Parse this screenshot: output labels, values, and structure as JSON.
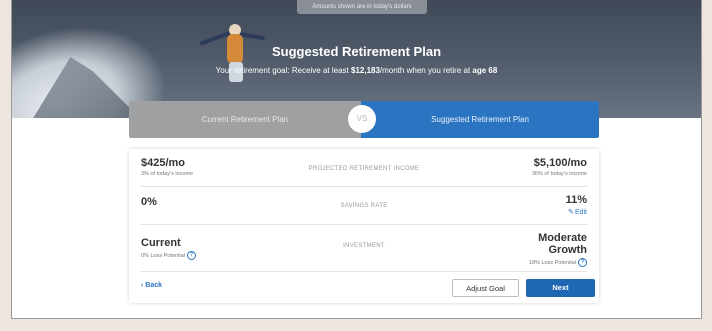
{
  "hero": {
    "amounts_tag": "Amounts shown are in today's dollars",
    "title": "Suggested Retirement Plan",
    "subtitle_prefix": "Your retirement goal: Receive at least ",
    "goal_amount": "$12,183",
    "subtitle_mid": "/month when you retire at ",
    "retire_age": "age 68"
  },
  "tabs": {
    "current_label": "Current Retirement Plan",
    "vs_label": "VS",
    "suggested_label": "Suggested Retirement Plan"
  },
  "rows": {
    "income": {
      "left_value": "$425/mo",
      "left_sub": "3% of today's income",
      "label": "PROJECTED RETIREMENT INCOME",
      "right_value": "$5,100/mo",
      "right_sub": "36% of today's income"
    },
    "savings": {
      "left_value": "0%",
      "label": "SAVINGS RATE",
      "right_value": "11%",
      "edit_label": "Edit"
    },
    "investment": {
      "left_value": "Current",
      "left_sub": "0% Loss Potential",
      "label": "INVESTMENT",
      "right_value_line1": "Moderate",
      "right_value_line2": "Growth",
      "right_sub": "18% Loss Potential"
    }
  },
  "actions": {
    "back_label": "Back",
    "adjust_label": "Adjust Goal",
    "next_label": "Next"
  },
  "icons": {
    "help": "question-circle",
    "edit": "pencil",
    "back": "chevron-left"
  },
  "colors": {
    "primary": "#1f66b3",
    "tab_suggested": "#2b74c2",
    "tab_current": "#9fa0a2"
  }
}
